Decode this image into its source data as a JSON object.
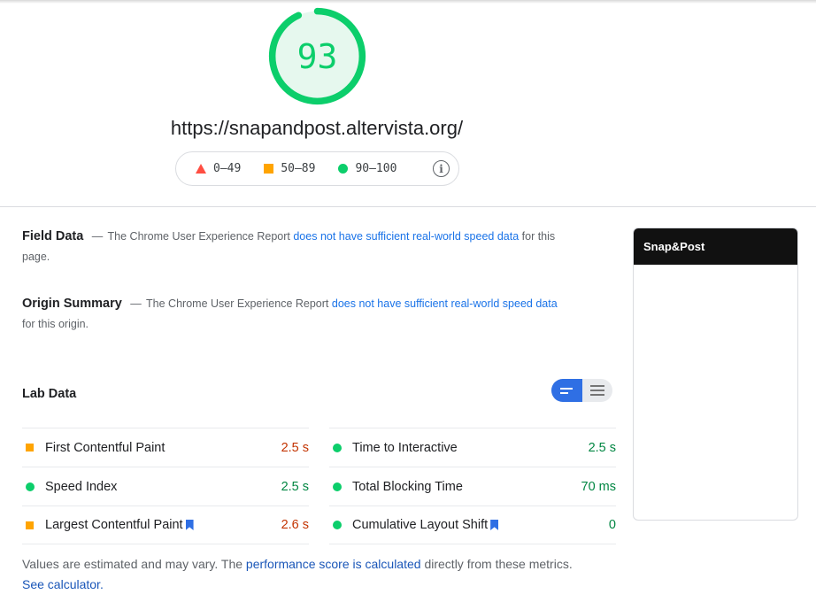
{
  "score": {
    "value": "93",
    "fraction": 0.93,
    "color": "#0cce6b",
    "track_color": "#e6f8ee"
  },
  "url": "https://snapandpost.altervista.org/",
  "legend": {
    "items": [
      {
        "label": "0–49",
        "shape": "triangle",
        "color": "#ff4e42"
      },
      {
        "label": "50–89",
        "shape": "square",
        "color": "#ffa400"
      },
      {
        "label": "90–100",
        "shape": "circle",
        "color": "#0cce6b"
      }
    ],
    "info_icon": "info-icon"
  },
  "field_data": {
    "title": "Field Data",
    "dash": "—",
    "text_before": "The Chrome User Experience Report",
    "link": "does not have sufficient real-world speed data",
    "text_after": "for this page."
  },
  "origin_summary": {
    "title": "Origin Summary",
    "dash": "—",
    "text_before": "The Chrome User Experience Report",
    "link": "does not have sufficient real-world speed data",
    "text_after": "for this origin."
  },
  "lab_data": {
    "title": "Lab Data",
    "toggle": {
      "active": "compact-view-icon",
      "inactive": "expanded-view-icon"
    },
    "metrics_left": [
      {
        "name": "First Contentful Paint",
        "value": "2.5 s",
        "status": "average",
        "indicator": "square",
        "bookmark": false
      },
      {
        "name": "Speed Index",
        "value": "2.5 s",
        "status": "pass",
        "indicator": "circle",
        "bookmark": false
      },
      {
        "name": "Largest Contentful Paint",
        "value": "2.6 s",
        "status": "average",
        "indicator": "square",
        "bookmark": true
      }
    ],
    "metrics_right": [
      {
        "name": "Time to Interactive",
        "value": "2.5 s",
        "status": "pass",
        "indicator": "circle",
        "bookmark": false
      },
      {
        "name": "Total Blocking Time",
        "value": "70 ms",
        "status": "pass",
        "indicator": "circle",
        "bookmark": false
      },
      {
        "name": "Cumulative Layout Shift",
        "value": "0",
        "status": "pass",
        "indicator": "circle",
        "bookmark": true
      }
    ]
  },
  "footnote": {
    "text_before": "Values are estimated and may vary. The",
    "link1": "performance score is calculated",
    "text_middle": "directly from these metrics.",
    "link2": "See calculator."
  },
  "thumbnail": {
    "header": "Snap&Post"
  },
  "colors": {
    "pass": "#018642",
    "average": "#c33300",
    "link": "#1a73e8",
    "toggle_active": "#2f6fe4"
  }
}
